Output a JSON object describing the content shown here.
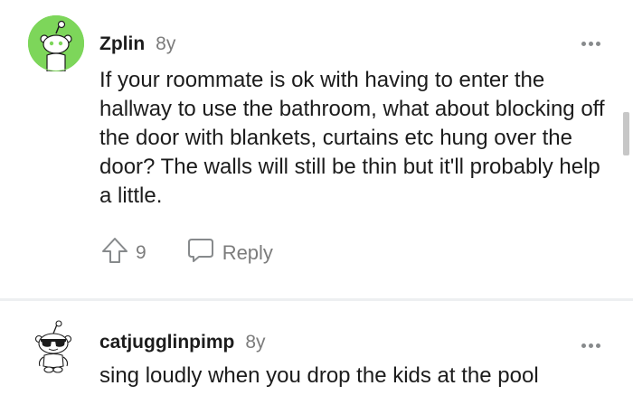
{
  "comments": [
    {
      "username": "Zplin",
      "age": "8y",
      "avatar_icon": "snoo-avatar-green-icon",
      "body": "If your roommate is ok with having to enter the hallway to use the bathroom, what about blocking off the door with blankets, curtains etc hung over the door? The walls will still be thin but it'll probably help a little.",
      "vote_count": "9",
      "reply_label": "Reply",
      "more_icon": "more-options-icon"
    },
    {
      "username": "catjugglinpimp",
      "age": "8y",
      "avatar_icon": "snoo-avatar-sunglasses-icon",
      "body": "sing loudly when you drop the kids at the pool",
      "more_icon": "more-options-icon"
    }
  ],
  "colors": {
    "avatar_green": "#7dd65a",
    "text": "#1c1c1c",
    "meta": "#7c7c7c",
    "divider": "#edeff1"
  }
}
